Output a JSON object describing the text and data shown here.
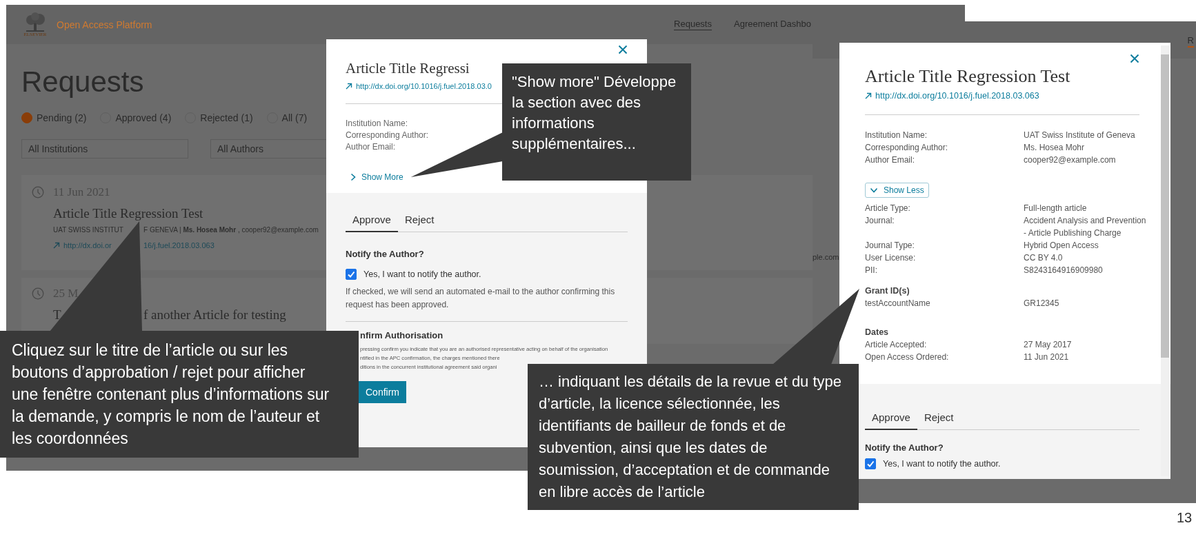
{
  "requests_screen": {
    "logo_text": "ELSEVIER",
    "app_title": "Open Access Platform",
    "nav": [
      {
        "label": "Requests",
        "selected": true
      },
      {
        "label": "Agreement Dashbo",
        "selected": false
      }
    ],
    "heading": "Requests",
    "status_filters": [
      {
        "label": "Pending (2)",
        "selected": true
      },
      {
        "label": "Approved (4)",
        "selected": false
      },
      {
        "label": "Rejected (1)",
        "selected": false
      },
      {
        "label": "All (7)",
        "selected": false
      }
    ],
    "dropdowns": [
      "All Institutions",
      "All Authors"
    ],
    "cards": [
      {
        "date": "11 Jun 2021",
        "title": [
          "Article Title Regression Test"
        ],
        "meta": [
          "UAT SWISS INSTITUT",
          "F GENEVA | **Ms. Hosea Mohr** , cooper92@example.com"
        ],
        "link": [
          "http://dx.doi.or",
          "16/j.fuel.2018.03.063"
        ]
      },
      {
        "date": "25 M",
        "title": [
          "T",
          "f another Article for testing"
        ]
      }
    ],
    "modal": {
      "title": "Article Title Regressi",
      "link": "http://dx.doi.org/10.1016/j.fuel.2018.03.0",
      "info_rows": [
        {
          "label": "Institution Name:"
        },
        {
          "label": "Corresponding Author:"
        },
        {
          "label": "Author Email:"
        }
      ],
      "toggle": {
        "label": "Show More",
        "expanded": false
      },
      "tabs": [
        {
          "label": "Approve",
          "selected": true
        },
        {
          "label": "Reject",
          "selected": false
        }
      ],
      "notify_heading": "Notify the Author?",
      "notify_checkbox": {
        "label": "Yes, I want to notify the author.",
        "checked": true
      },
      "notify_note": "If checked, we will send an automated e-mail to the author confirming this request has been approved.",
      "confirm_heading": "nfirm Authorisation",
      "confirm_note_lines": [
        "pressing confirm you indicate that you are an authorised representative acting on behalf of the organisation",
        "ntified in the APC confirmation, the charges mentioned there",
        "ditions in the concurrent institutional agreement said organi"
      ],
      "confirm_button": "Confirm"
    }
  },
  "detail_screen": {
    "nav": [
      {
        "label": "R",
        "selected": true
      }
    ],
    "peek_text": "ple.com",
    "modal": {
      "title": "Article Title Regression Test",
      "link": "http://dx.doi.org/10.1016/j.fuel.2018.03.063",
      "info_rows": [
        {
          "label": "Institution Name:",
          "value": [
            "UAT Swiss Institute of Geneva"
          ]
        },
        {
          "label": "Corresponding Author:",
          "value": [
            "Ms. Hosea Mohr"
          ]
        },
        {
          "label": "Author Email:",
          "value": [
            "cooper92@example.com"
          ]
        }
      ],
      "toggle": {
        "label": "Show Less",
        "expanded": true
      },
      "detail_rows": [
        {
          "label": "Article Type:",
          "value": [
            "Full-length article"
          ]
        },
        {
          "label": "Journal:",
          "value": [
            "Accident Analysis and Prevention",
            "- Article Publishing Charge"
          ]
        },
        {
          "label": "Journal Type:",
          "value": [
            "Hybrid Open Access"
          ]
        },
        {
          "label": "User License:",
          "value": [
            "CC BY 4.0"
          ]
        },
        {
          "label": "PII:",
          "value": [
            "S8243164916909980"
          ]
        }
      ],
      "grants": {
        "heading": "Grant ID(s)",
        "rows": [
          {
            "label": "testAccountName",
            "value": [
              "GR12345"
            ]
          }
        ]
      },
      "dates": {
        "heading": "Dates",
        "rows": [
          {
            "label": "Article Accepted:",
            "value": [
              "27 May 2017"
            ]
          },
          {
            "label": "Open Access Ordered:",
            "value": [
              "11 Jun 2021"
            ]
          }
        ]
      },
      "tabs": [
        {
          "label": "Approve",
          "selected": true
        },
        {
          "label": "Reject",
          "selected": false
        }
      ],
      "notify_heading": "Notify the Author?",
      "notify_checkbox": {
        "label": "Yes, I want to notify the author.",
        "checked": true
      }
    }
  },
  "callouts": [
    {
      "kind": "pointer-up",
      "text": "Cliquez sur le titre de l’article ou sur les boutons d’approbation / rejet pour afficher une fenêtre contenant plus d’informations sur la demande, y compris le nom de l’auteur et les coordonnées"
    },
    {
      "kind": "pointer-left",
      "text": "\"Show more\" Développe la section avec des informations supplémentaires..."
    },
    {
      "kind": "pointer-up",
      "text": "… indiquant les détails de la revue et du type d’article, la licence sélectionnée, les identifiants de bailleur de fonds et de subvention, ainsi que les dates de soumission, d’acceptation et de commande en libre accès de l’article"
    }
  ],
  "page_number": "13"
}
